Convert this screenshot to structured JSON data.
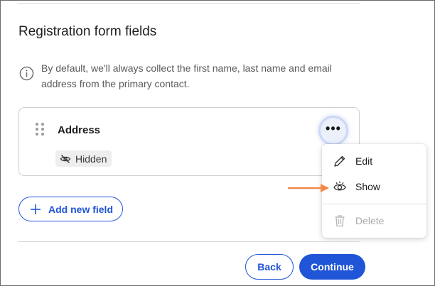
{
  "section": {
    "title": "Registration form fields",
    "info_icon": "info-circle-icon",
    "info_text": "By default, we'll always collect the first name, last name and email address from the primary contact."
  },
  "field_card": {
    "drag_icon": "drag-handle-icon",
    "name": "Address",
    "status_icon": "eye-slash-icon",
    "status": "Hidden",
    "more_icon": "more-horizontal-icon",
    "more_label": "•••"
  },
  "context_menu": {
    "items": [
      {
        "label": "Edit",
        "icon": "pencil-icon",
        "enabled": true
      },
      {
        "label": "Show",
        "icon": "eye-icon",
        "enabled": true
      },
      {
        "label": "Delete",
        "icon": "trash-icon",
        "enabled": false
      }
    ]
  },
  "annotation": {
    "arrow_color": "#f08a4b",
    "points_to": "Show"
  },
  "actions": {
    "add_field_icon": "plus-icon",
    "add_field_label": "Add new field",
    "back_label": "Back",
    "continue_label": "Continue"
  },
  "colors": {
    "primary": "#1f55d6",
    "badge_bg": "#eeeeee",
    "disabled_text": "#a9a9a9"
  }
}
